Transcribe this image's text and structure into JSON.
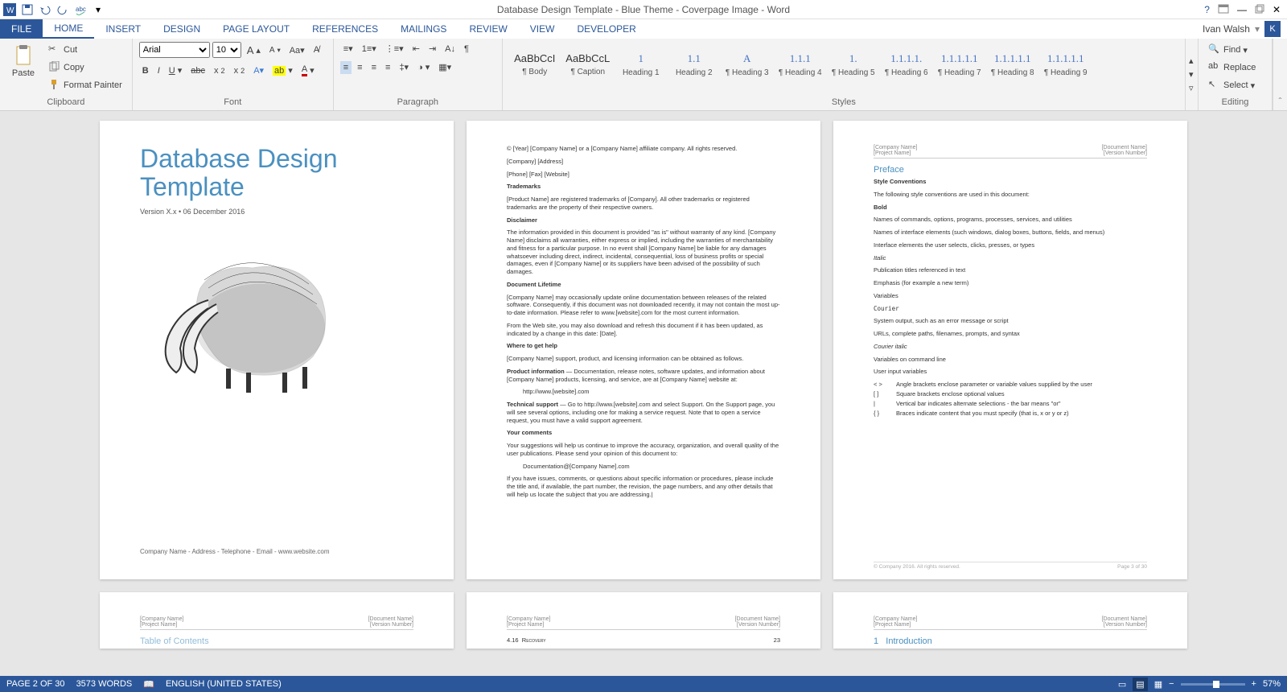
{
  "titlebar": {
    "title": "Database Design Template - Blue Theme - Coverpage Image - Word"
  },
  "tabs": {
    "file": "FILE",
    "items": [
      "HOME",
      "INSERT",
      "DESIGN",
      "PAGE LAYOUT",
      "REFERENCES",
      "MAILINGS",
      "REVIEW",
      "VIEW",
      "DEVELOPER"
    ],
    "active": "HOME"
  },
  "user": {
    "name": "Ivan Walsh",
    "initial": "K"
  },
  "ribbon": {
    "clipboard": {
      "label": "Clipboard",
      "paste": "Paste",
      "cut": "Cut",
      "copy": "Copy",
      "format_painter": "Format Painter"
    },
    "font": {
      "label": "Font",
      "name": "Arial",
      "size": "10"
    },
    "paragraph": {
      "label": "Paragraph"
    },
    "styles": {
      "label": "Styles",
      "items": [
        {
          "preview": "AaBbCcI",
          "name": "¶ Body"
        },
        {
          "preview": "AaBbCcL",
          "name": "¶ Caption"
        },
        {
          "preview": "1",
          "name": "Heading 1"
        },
        {
          "preview": "1.1",
          "name": "Heading 2"
        },
        {
          "preview": "A",
          "name": "¶ Heading 3"
        },
        {
          "preview": "1.1.1",
          "name": "¶ Heading 4"
        },
        {
          "preview": "1.",
          "name": "¶ Heading 5"
        },
        {
          "preview": "1.1.1.1.",
          "name": "¶ Heading 6"
        },
        {
          "preview": "1.1.1.1.1",
          "name": "¶ Heading 7"
        },
        {
          "preview": "1.1.1.1.1",
          "name": "¶ Heading 8"
        },
        {
          "preview": "1.1.1.1.1",
          "name": "¶ Heading 9"
        }
      ]
    },
    "editing": {
      "label": "Editing",
      "find": "Find",
      "replace": "Replace",
      "select": "Select"
    }
  },
  "doc": {
    "cover": {
      "title_l1": "Database Design",
      "title_l2": "Template",
      "version_line": "Version X.x • 06 December 2016",
      "footer": "Company Name - Address - Telephone - Email - www.website.com"
    },
    "header": {
      "company": "[Company Name]",
      "project": "[Project Name]",
      "docname": "[Document Name]",
      "version": "[Version Number]"
    },
    "page2": {
      "copy": "© [Year] [Company Name] or a [Company Name] affiliate company. All rights reserved.",
      "addr": "[Company] [Address]",
      "contact": "[Phone] [Fax] [Website]",
      "tm_h": "Trademarks",
      "tm_b": "[Product Name] are registered trademarks of [Company]. All other trademarks or registered trademarks are the property of their respective owners.",
      "disc_h": "Disclaimer",
      "disc_b": "The information provided in this document is provided \"as is\" without warranty of any kind. [Company Name] disclaims all warranties, either express or implied, including the warranties of merchantability and fitness for a particular purpose. In no event shall [Company Name] be liable for any damages whatsoever including direct, indirect, incidental, consequential, loss of business profits or special damages, even if [Company Name] or its suppliers have been advised of the possibility of such damages.",
      "life_h": "Document Lifetime",
      "life_b1": "[Company Name] may occasionally update online documentation between releases of the related software. Consequently, if this document was not downloaded recently, it may not contain the most up-to-date information. Please refer to www.[website].com for the most current information.",
      "life_b2": "From the Web site, you may also download and refresh this document if it has been updated, as indicated by a change in this date: [Date].",
      "help_h": "Where to get help",
      "help_b": "[Company Name] support, product, and licensing information can be obtained as follows.",
      "pi_h": "Product information",
      "pi_b": " — Documentation, release notes, software updates, and information about [Company Name] products, licensing, and service, are at [Company Name] website at:",
      "pi_url": "http://www.[website].com",
      "ts_h": "Technical support",
      "ts_b": " — Go to http://www.[website].com and select Support. On the Support page, you will see several options, including one for making a service request. Note that to open a service request, you must have a valid support agreement.",
      "yc_h": "Your comments",
      "yc_b1": "Your suggestions will help us continue to improve the accuracy, organization, and overall quality of the user publications. Please send your opinion of this document to:",
      "yc_email": "Documentation@[Company Name].com",
      "yc_b2": "If you have issues, comments, or questions about specific information or procedures, please include the title and, if available, the part number, the revision, the page numbers, and any other details that will help us locate the subject that you are addressing.|"
    },
    "page3": {
      "preface": "Preface",
      "sc_h": "Style Conventions",
      "sc_intro": "The following style conventions are used in this document:",
      "bold": "Bold",
      "bold_l1": "Names of commands, options, programs, processes, services, and utilities",
      "bold_l2": "Names of interface elements (such windows, dialog boxes, buttons, fields, and menus)",
      "bold_l3": "Interface elements the user selects, clicks, presses, or types",
      "italic": "Italic",
      "italic_l1": "Publication titles referenced in text",
      "italic_l2": "Emphasis (for example a new term)",
      "italic_l3": "Variables",
      "courier": "Courier",
      "courier_l1": "System output, such as an error message or script",
      "courier_l2": "URLs, complete paths, filenames, prompts, and syntax",
      "ci": "Courier italic",
      "ci_l1": "Variables on command line",
      "ci_l2": "User input variables",
      "sym1": "< >",
      "sym1_d": "Angle brackets enclose parameter or variable values supplied by the user",
      "sym2": "[ ]",
      "sym2_d": "Square brackets enclose optional values",
      "sym3": "|",
      "sym3_d": "Vertical bar indicates alternate selections - the bar means \"or\"",
      "sym4": "{ }",
      "sym4_d": "Braces indicate content that you must specify (that is, x or y or z)",
      "footer_l": "© Company 2016. All rights reserved.",
      "footer_r": "Page 3 of 30"
    },
    "partial": {
      "toc": "Table of Contents",
      "recovery_num": "4.16",
      "recovery": "Recovery",
      "recovery_pg": "23",
      "intro_num": "1",
      "intro": "Introduction"
    }
  },
  "status": {
    "page": "PAGE 2 OF 30",
    "words": "3573 WORDS",
    "lang": "ENGLISH (UNITED STATES)",
    "zoom": "57%"
  }
}
